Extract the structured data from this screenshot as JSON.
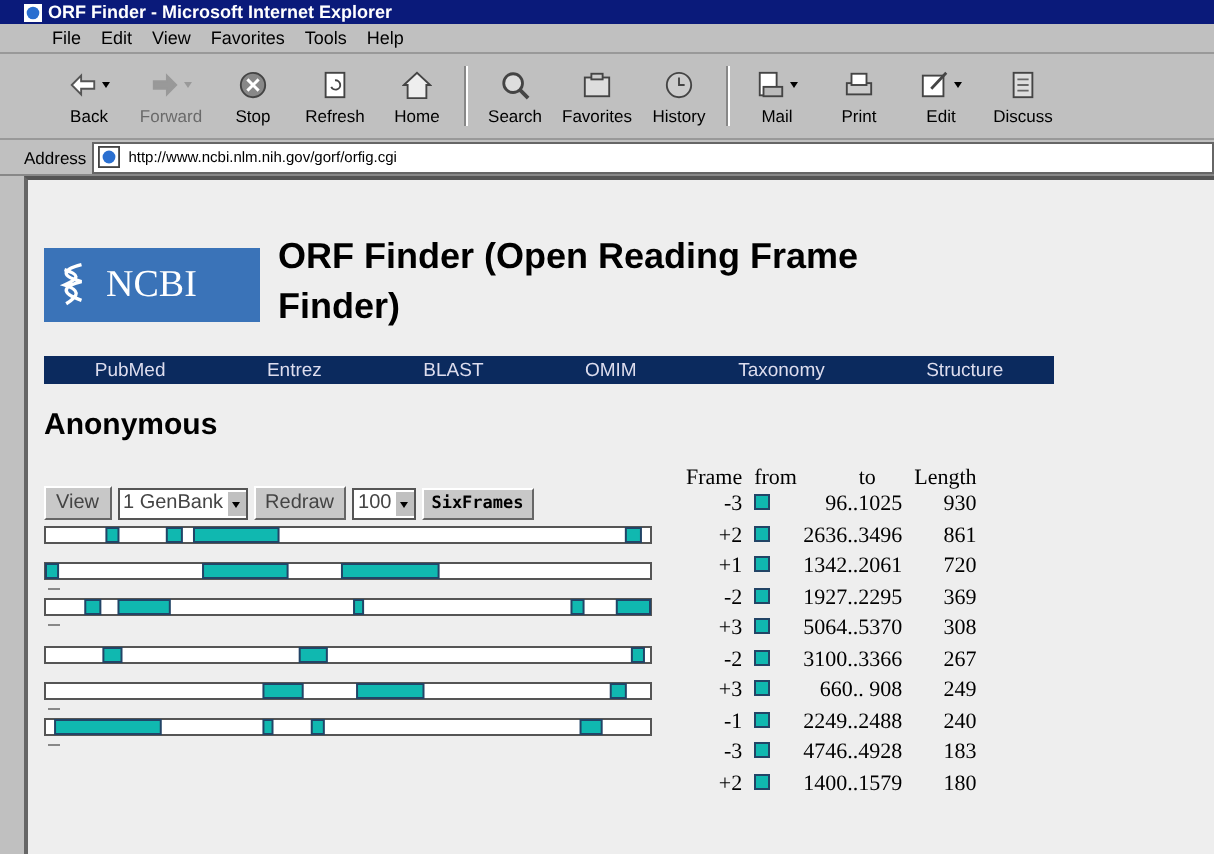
{
  "window": {
    "title": "ORF Finder - Microsoft Internet Explorer"
  },
  "menu": [
    "File",
    "Edit",
    "View",
    "Favorites",
    "Tools",
    "Help"
  ],
  "toolbar": [
    {
      "kind": "back",
      "label": "Back",
      "disabled": false,
      "dropdown": true
    },
    {
      "kind": "forward",
      "label": "Forward",
      "disabled": true,
      "dropdown": true
    },
    {
      "kind": "stop",
      "label": "Stop",
      "disabled": false,
      "dropdown": false
    },
    {
      "kind": "refresh",
      "label": "Refresh",
      "disabled": false,
      "dropdown": false
    },
    {
      "kind": "home",
      "label": "Home",
      "disabled": false,
      "dropdown": false
    },
    {
      "kind": "search",
      "label": "Search",
      "disabled": false,
      "dropdown": false
    },
    {
      "kind": "favorites",
      "label": "Favorites",
      "disabled": false,
      "dropdown": false
    },
    {
      "kind": "history",
      "label": "History",
      "disabled": false,
      "dropdown": false
    },
    {
      "kind": "mail",
      "label": "Mail",
      "disabled": false,
      "dropdown": true
    },
    {
      "kind": "print",
      "label": "Print",
      "disabled": false,
      "dropdown": false
    },
    {
      "kind": "edit",
      "label": "Edit",
      "disabled": false,
      "dropdown": true
    },
    {
      "kind": "discuss",
      "label": "Discuss",
      "disabled": false,
      "dropdown": false
    }
  ],
  "address": {
    "label": "Address",
    "value": "http://www.ncbi.nlm.nih.gov/gorf/orfig.cgi"
  },
  "page": {
    "logo_text": "NCBI",
    "title": "ORF Finder (Open Reading Frame Finder)",
    "nav": [
      "PubMed",
      "Entrez",
      "BLAST",
      "OMIM",
      "Taxonomy",
      "Structure"
    ],
    "heading": "Anonymous",
    "controls": {
      "view_button": "View",
      "view_select": "1 GenBank",
      "redraw_button": "Redraw",
      "zoom_select": "100",
      "sixframes_button": "SixFrames"
    },
    "orf_table": {
      "columns": [
        "Frame",
        "from",
        "to",
        "Length"
      ],
      "rows": [
        {
          "frame": "-3",
          "range": "96..1025",
          "length": "930"
        },
        {
          "frame": "+2",
          "range": "2636..3496",
          "length": "861"
        },
        {
          "frame": "+1",
          "range": "1342..2061",
          "length": "720"
        },
        {
          "frame": "-2",
          "range": "1927..2295",
          "length": "369"
        },
        {
          "frame": "+3",
          "range": "5064..5370",
          "length": "308"
        },
        {
          "frame": "-2",
          "range": "3100..3366",
          "length": "267"
        },
        {
          "frame": "+3",
          "range": "660.. 908",
          "length": "249"
        },
        {
          "frame": "-1",
          "range": "2249..2488",
          "length": "240"
        },
        {
          "frame": "-3",
          "range": "4746..4928",
          "length": "183"
        },
        {
          "frame": "+2",
          "range": "1400..1579",
          "length": "180"
        }
      ]
    }
  }
}
